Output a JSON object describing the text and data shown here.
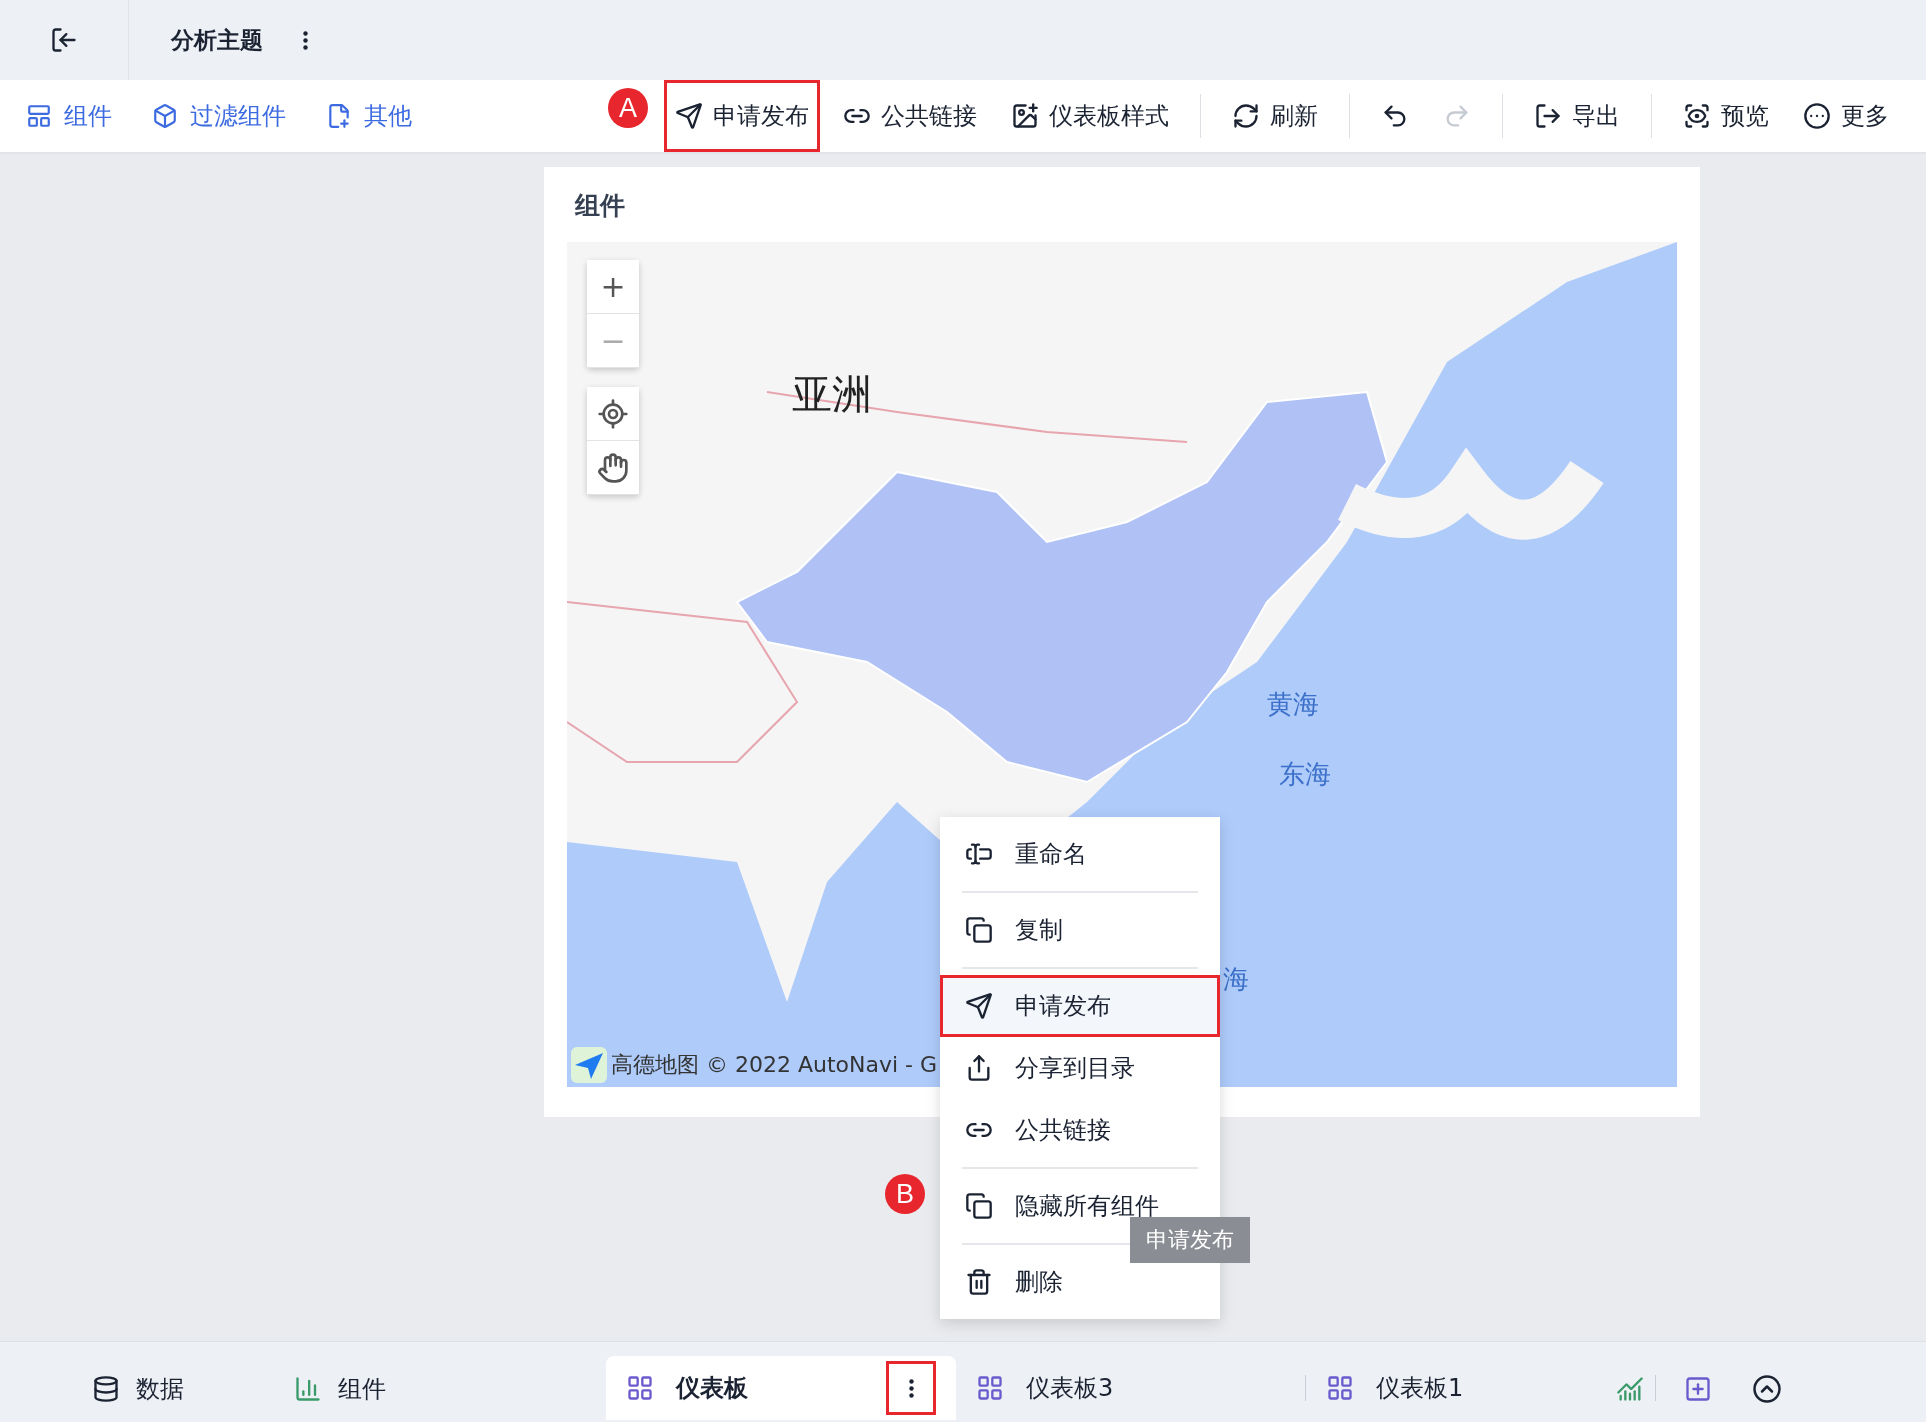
{
  "header": {
    "title": "分析主题"
  },
  "toolbar": {
    "left": [
      {
        "label": "组件"
      },
      {
        "label": "过滤组件"
      },
      {
        "label": "其他"
      }
    ],
    "groups": [
      [
        {
          "label": "申请发布",
          "highlighted": true,
          "callout": "A",
          "disabled": false
        },
        {
          "label": "公共链接",
          "highlighted": false,
          "disabled": false
        },
        {
          "label": "仪表板样式",
          "highlighted": false,
          "disabled": false
        }
      ],
      [
        {
          "label": "刷新",
          "highlighted": false,
          "disabled": false
        }
      ],
      [
        {
          "highlighted": false,
          "disabled": false
        },
        {
          "highlighted": false,
          "disabled": true
        }
      ],
      [
        {
          "label": "导出",
          "highlighted": false,
          "disabled": false
        }
      ],
      [
        {
          "label": "预览",
          "highlighted": false,
          "disabled": false
        },
        {
          "label": "更多",
          "highlighted": false,
          "disabled": false
        }
      ]
    ]
  },
  "card": {
    "title": "组件",
    "map": {
      "zoom_in": "+",
      "zoom_out": "−",
      "labels": [
        {
          "text": "亚洲",
          "kind": "continent"
        },
        {
          "text": "黄海",
          "kind": "sea"
        },
        {
          "text": "东海",
          "kind": "sea"
        },
        {
          "text": "海",
          "kind": "sea"
        }
      ],
      "attribution": "高德地图 © 2022 AutoNavi - G"
    }
  },
  "context_menu": {
    "callout": "B",
    "groups": [
      [
        {
          "label": "重命名",
          "highlighted": false
        }
      ],
      [
        {
          "label": "复制",
          "highlighted": false
        }
      ],
      [
        {
          "label": "申请发布",
          "highlighted": true
        },
        {
          "label": "分享到目录",
          "highlighted": false
        },
        {
          "label": "公共链接",
          "highlighted": false
        }
      ],
      [
        {
          "label": "隐藏所有组件",
          "highlighted": false
        }
      ],
      [
        {
          "label": "删除",
          "highlighted": false
        }
      ]
    ],
    "tooltip": "申请发布"
  },
  "bottom_bar": {
    "nav": [
      {
        "label": "数据"
      },
      {
        "label": "组件"
      }
    ],
    "tabs": [
      {
        "label": "仪表板",
        "selected": true,
        "menu_highlighted": true
      },
      {
        "label": "仪表板3",
        "selected": false,
        "menu_highlighted": false
      },
      {
        "label": "仪表板1",
        "selected": false,
        "menu_highlighted": false
      }
    ]
  }
}
